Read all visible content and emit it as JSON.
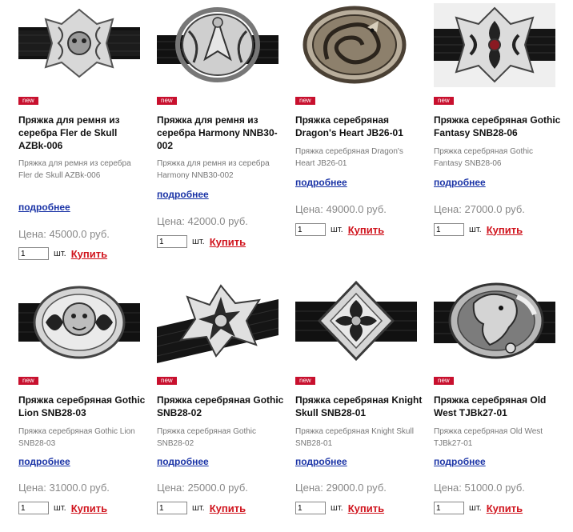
{
  "accent": "#c8102e",
  "link_color": "#1a33a6",
  "products": [
    {
      "image": "belt-buckle-fleur-de-skull",
      "badge": "new",
      "title": "Пряжка для ремня из серебра Fler de Skull AZBk-006",
      "desc": "Пряжка для ремня из серебра Fler de Skull AZBk-006",
      "more": "подробнее",
      "price": "Цена: 45000.0 руб.",
      "qty": "1",
      "unit": "шт.",
      "buy": "Купить"
    },
    {
      "image": "belt-buckle-harmony",
      "badge": "new",
      "title": "Пряжка для ремня из серебра Harmony NNB30-002",
      "desc": "Пряжка для ремня из серебра Harmony NNB30-002",
      "more": "подробнее",
      "price": "Цена: 42000.0 руб.",
      "qty": "1",
      "unit": "шт.",
      "buy": "Купить"
    },
    {
      "image": "belt-buckle-dragons-heart",
      "badge": "new",
      "title": "Пряжка серебряная Dragon's Heart JB26-01",
      "desc": "Пряжка серебряная Dragon's Heart JB26-01",
      "more": "подробнее",
      "price": "Цена: 49000.0 руб.",
      "qty": "1",
      "unit": "шт.",
      "buy": "Купить"
    },
    {
      "image": "belt-buckle-gothic-fantasy",
      "badge": "new",
      "title": "Пряжка серебряная Gothic Fantasy SNB28-06",
      "desc": "Пряжка серебряная Gothic Fantasy SNB28-06",
      "more": "подробнее",
      "price": "Цена: 27000.0 руб.",
      "qty": "1",
      "unit": "шт.",
      "buy": "Купить"
    },
    {
      "image": "belt-buckle-gothic-lion",
      "badge": "new",
      "title": "Пряжка серебряная Gothic Lion SNB28-03",
      "desc": "Пряжка серебряная Gothic Lion SNB28-03",
      "more": "подробнее",
      "price": "Цена: 31000.0 руб.",
      "qty": "1",
      "unit": "шт.",
      "buy": "Купить"
    },
    {
      "image": "belt-buckle-gothic",
      "badge": "new",
      "title": "Пряжка серебряная Gothic SNB28-02",
      "desc": "Пряжка серебряная Gothic SNB28-02",
      "more": "подробнее",
      "price": "Цена: 25000.0 руб.",
      "qty": "1",
      "unit": "шт.",
      "buy": "Купить"
    },
    {
      "image": "belt-buckle-knight-skull",
      "badge": "new",
      "title": "Пряжка серебряная Knight Skull SNB28-01",
      "desc": "Пряжка серебряная Knight Skull SNB28-01",
      "more": "подробнее",
      "price": "Цена: 29000.0 руб.",
      "qty": "1",
      "unit": "шт.",
      "buy": "Купить"
    },
    {
      "image": "belt-buckle-old-west",
      "badge": "new",
      "title": "Пряжка серебряная Old West TJBk27-01",
      "desc": "Пряжка серебряная Old West TJBk27-01",
      "more": "подробнее",
      "price": "Цена: 51000.0 руб.",
      "qty": "1",
      "unit": "шт.",
      "buy": "Купить"
    }
  ]
}
